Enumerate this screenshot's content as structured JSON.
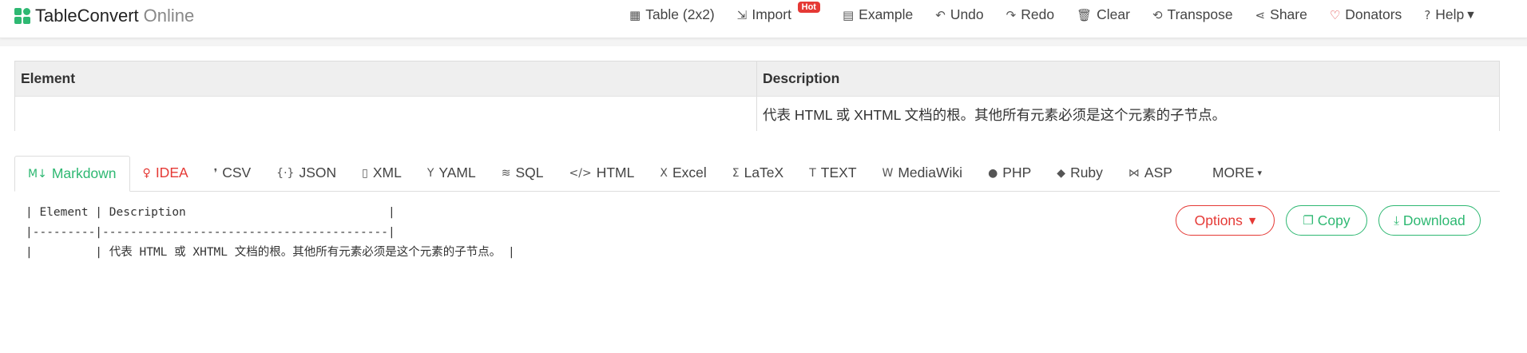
{
  "brand": {
    "main": "TableConvert",
    "sub": "Online"
  },
  "nav": [
    {
      "name": "table-size-button",
      "icon": "table-icon",
      "glyph": "▦",
      "label": "Table (2x2)"
    },
    {
      "name": "import-button",
      "icon": "import-icon",
      "glyph": "⇲",
      "label": "Import",
      "badge": "Hot"
    },
    {
      "name": "example-button",
      "icon": "example-icon",
      "glyph": "▤",
      "label": "Example"
    },
    {
      "name": "undo-button",
      "icon": "undo-icon",
      "glyph": "↶",
      "label": "Undo"
    },
    {
      "name": "redo-button",
      "icon": "redo-icon",
      "glyph": "↷",
      "label": "Redo"
    },
    {
      "name": "clear-button",
      "icon": "trash-icon",
      "glyph": "🗑",
      "label": "Clear"
    },
    {
      "name": "transpose-button",
      "icon": "transpose-icon",
      "glyph": "⟲",
      "label": "Transpose"
    },
    {
      "name": "share-button",
      "icon": "share-icon",
      "glyph": "⋖",
      "label": "Share"
    },
    {
      "name": "donators-button",
      "icon": "heart-icon",
      "glyph": "♡",
      "label": "Donators"
    },
    {
      "name": "help-button",
      "icon": "help-icon",
      "glyph": "?",
      "label": "Help"
    }
  ],
  "table": {
    "headers": [
      "Element",
      "Description"
    ],
    "rows": [
      [
        "",
        "代表 HTML 或 XHTML 文档的根。其他所有元素必须是这个元素的子节点。"
      ]
    ]
  },
  "tabs": [
    {
      "label": "Markdown",
      "icon": "markdown-icon",
      "glyph": "M↓",
      "active": true
    },
    {
      "label": "IDEA",
      "icon": "lightbulb-icon",
      "glyph": "♀"
    },
    {
      "label": "CSV",
      "icon": "csv-icon",
      "glyph": "❜"
    },
    {
      "label": "JSON",
      "icon": "json-icon",
      "glyph": "{·}"
    },
    {
      "label": "XML",
      "icon": "xml-icon",
      "glyph": "▯"
    },
    {
      "label": "YAML",
      "icon": "yaml-icon",
      "glyph": "Y"
    },
    {
      "label": "SQL",
      "icon": "database-icon",
      "glyph": "≋"
    },
    {
      "label": "HTML",
      "icon": "code-icon",
      "glyph": "</>"
    },
    {
      "label": "Excel",
      "icon": "excel-icon",
      "glyph": "X"
    },
    {
      "label": "LaTeX",
      "icon": "sigma-icon",
      "glyph": "Σ"
    },
    {
      "label": "TEXT",
      "icon": "text-icon",
      "glyph": "T"
    },
    {
      "label": "MediaWiki",
      "icon": "wiki-icon",
      "glyph": "W"
    },
    {
      "label": "PHP",
      "icon": "php-icon",
      "glyph": "●"
    },
    {
      "label": "Ruby",
      "icon": "ruby-icon",
      "glyph": "◆"
    },
    {
      "label": "ASP",
      "icon": "asp-icon",
      "glyph": "⋈"
    },
    {
      "label": "MORE",
      "icon": "caret-down-icon",
      "glyph": "▾",
      "more": true
    }
  ],
  "code": {
    "lines": [
      "| Element | Description                             |",
      "|---------|-----------------------------------------|",
      "|         | 代表 HTML 或 XHTML 文档的根。其他所有元素必须是这个元素的子节点。 |"
    ]
  },
  "actions": {
    "options_label": "Options",
    "copy_label": "Copy",
    "download_label": "Download"
  },
  "colors": {
    "accent": "#2eb872",
    "danger": "#e53935"
  }
}
